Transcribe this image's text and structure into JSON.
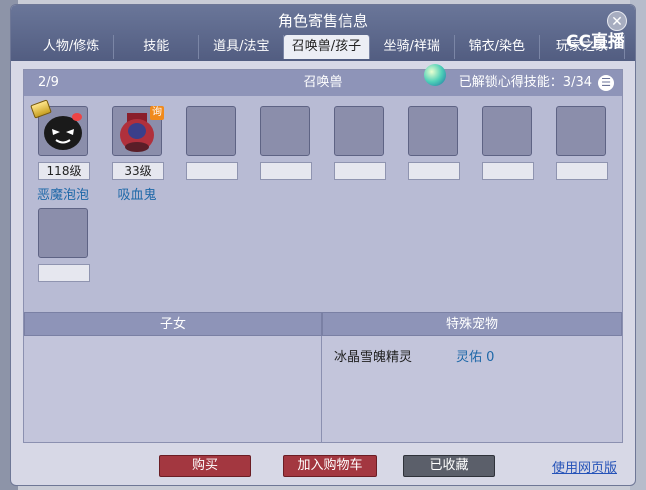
{
  "window": {
    "title": "角色寄售信息",
    "close_label": "✕",
    "watermark": "CC直播"
  },
  "tabs": [
    {
      "label": "人物/修炼"
    },
    {
      "label": "技能"
    },
    {
      "label": "道具/法宝"
    },
    {
      "label": "召唤兽/孩子"
    },
    {
      "label": "坐骑/祥瑞"
    },
    {
      "label": "锦衣/染色"
    },
    {
      "label": "玩家之家"
    }
  ],
  "summons": {
    "count": "2/9",
    "title": "召唤兽",
    "skills_label": "已解锁心得技能：3/34",
    "menu_icon": "list-icon",
    "pets": [
      {
        "level": "118级",
        "name": "恶魔泡泡"
      },
      {
        "level": "33级",
        "name": "吸血鬼",
        "badge": "询"
      }
    ]
  },
  "children": {
    "title": "子女"
  },
  "special_pets": {
    "title": "特殊宠物",
    "items": [
      {
        "name": "冰晶雪魄精灵",
        "value": "灵佑 0"
      }
    ]
  },
  "footer": {
    "buy_label": "购买",
    "cart_label": "加入购物车",
    "fav_label": "已收藏",
    "web_label": "使用网页版"
  },
  "colors": {
    "titlebar": "#5a6589",
    "panel": "#b8bbd4",
    "accent_blue": "#1e68a8",
    "btn_red": "#a33740",
    "btn_gray": "#5b5f6a"
  }
}
